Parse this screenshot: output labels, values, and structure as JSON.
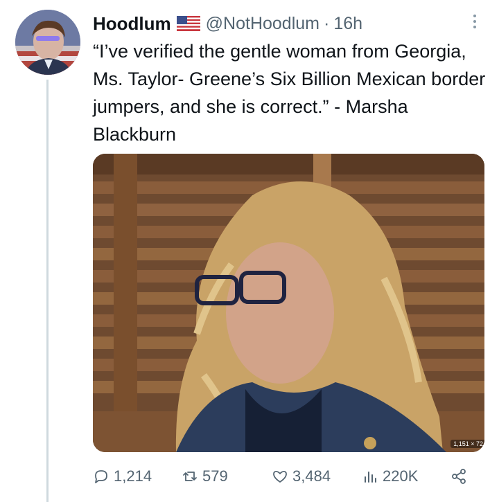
{
  "author": {
    "name": "Hoodlum",
    "handle": "@NotHoodlum",
    "separator": "·",
    "time": "16h"
  },
  "tweet": {
    "text": "“I’ve verified the gentle woman from Georgia, Ms. Taylor- Greene’s Six Billion Mexican border jumpers, and she is correct.” - Marsha Blackburn"
  },
  "media": {
    "badge": "1,151 × 72"
  },
  "actions": {
    "replies": "1,214",
    "retweets": "579",
    "likes": "3,484",
    "views": "220K"
  },
  "icons": {
    "reply": "reply-icon",
    "retweet": "retweet-icon",
    "like": "heart-icon",
    "views": "views-chart-icon",
    "share": "share-icon",
    "more": "more-dots-icon",
    "flag": "us-flag-icon"
  },
  "colors": {
    "text": "#0f1419",
    "secondary": "#536471",
    "thread_line": "#cfd9de"
  }
}
